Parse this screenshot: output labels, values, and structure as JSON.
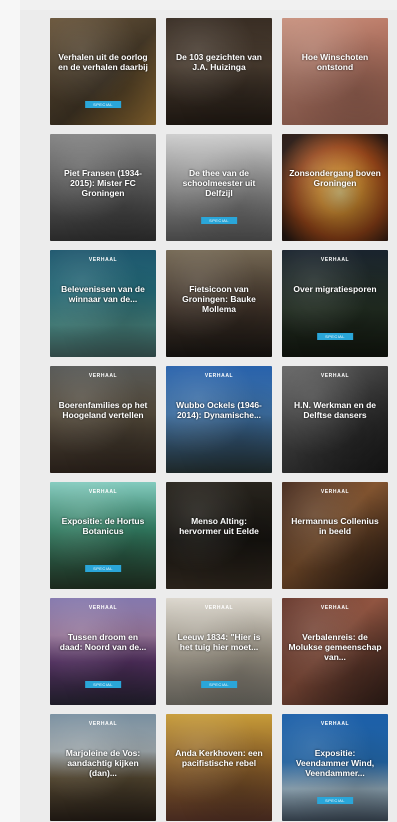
{
  "cards": [
    {
      "tag": "",
      "title": "Verhalen uit de oorlog en de verhalen daarbij",
      "badge": "SPECIAL",
      "meta": "",
      "bg": "linear-gradient(135deg,#6f5a3e,#4d3f2c 55%,#c08f42)"
    },
    {
      "tag": "",
      "title": "De 103 gezichten van J.A. Huizinga",
      "badge": "",
      "meta": "",
      "bg": "linear-gradient(180deg,#3b2f25,#5a4a3b 45%,#2b2119)"
    },
    {
      "tag": "",
      "title": "Hoe Winschoten ontstond",
      "badge": "",
      "meta": "",
      "bg": "linear-gradient(135deg,#d39a86,#c7836f 55%,#bf7b66)"
    },
    {
      "tag": "",
      "title": "Piet Fransen (1934-2015): Mister FC Groningen",
      "badge": "",
      "meta": "",
      "bg": "linear-gradient(180deg,#8b8b8b,#6d6d6d 55%,#3f3f3f)"
    },
    {
      "tag": "",
      "title": "De thee van de schoolmeester uit Delfzijl",
      "badge": "SPECIAL",
      "meta": "",
      "bg": "linear-gradient(180deg,#d9d9d9,#a7a7a7 55%,#6b6b6b)"
    },
    {
      "tag": "",
      "title": "Zonsondergang boven Groningen",
      "badge": "",
      "meta": "",
      "bg": "radial-gradient(circle at 55% 55%,#ffe08a 0%,#f2a339 25%,#a74d1c 55%,#2a1a14 85%)"
    },
    {
      "tag": "VERHAAL",
      "title": "Belevenissen van de winnaar van de...",
      "badge": "",
      "meta": "",
      "bg": "linear-gradient(180deg,#1f5b73,#2b7e8e 40%,#5aa7a1 70%,#4b6f6c)"
    },
    {
      "tag": "",
      "title": "Fietsicoon van Groningen: Bauke Mollema",
      "badge": "",
      "meta": "",
      "bg": "linear-gradient(180deg,#7a6d58,#4f3f33 55%,#1e1a16)"
    },
    {
      "tag": "VERHAAL",
      "title": "Over migratiesporen",
      "badge": "SPECIAL",
      "meta": "",
      "bg": "linear-gradient(180deg,#1b2530,#2c3b2c 55%,#151a11)"
    },
    {
      "tag": "VERHAAL",
      "title": "Boerenfamilies op het Hoogeland vertellen",
      "badge": "",
      "meta": "",
      "bg": "linear-gradient(180deg,#5a5c5a,#6a5e4b 45%,#3a2d24)"
    },
    {
      "tag": "VERHAAL",
      "title": "Wubbo Ockels (1946-2014): Dynamische...",
      "badge": "",
      "meta": "",
      "bg": "linear-gradient(180deg,#2a67b5,#4c8ac9 45%,#2d3c3e)"
    },
    {
      "tag": "VERHAAL",
      "title": "H.N. Werkman en de Delftse dansers",
      "badge": "",
      "meta": "",
      "bg": "linear-gradient(135deg,#6d6d6d,#3e3e3e 55%,#1e1e1e)"
    },
    {
      "tag": "VERHAAL",
      "title": "Expositie: de Hortus Botanicus",
      "badge": "SPECIAL",
      "meta": "",
      "bg": "linear-gradient(180deg,#8bd6c9,#3f9b7a 45%,#2b3f2c)"
    },
    {
      "tag": "",
      "title": "Menso Alting: hervormer uit Eelde",
      "badge": "",
      "meta": "",
      "bg": "linear-gradient(180deg,#2a261f,#1b1813 55%,#3f3428)"
    },
    {
      "tag": "VERHAAL",
      "title": "Hermannus Collenius in beeld",
      "badge": "",
      "meta": "",
      "bg": "linear-gradient(135deg,#4a2d1f,#8b5a33 45%,#2b1c14)"
    },
    {
      "tag": "VERHAAL",
      "title": "Tussen droom en daad: Noord van de...",
      "badge": "SPECIAL",
      "meta": "",
      "bg": "linear-gradient(180deg,#8b7fb7,#b28bb5 35%,#6b3f7d 60%,#2e2b3d)"
    },
    {
      "tag": "VERHAAL",
      "title": "Leeuw 1834: \"Hier is het tuig hier moet...",
      "badge": "SPECIAL",
      "meta": "",
      "bg": "linear-gradient(180deg,#e7e2d8,#bfb6a4 55%,#8e8a80)"
    },
    {
      "tag": "VERHAAL",
      "title": "Verbalenreis: de Molukse gemeenschap van...",
      "badge": "",
      "meta": "",
      "bg": "linear-gradient(135deg,#6d3b2f,#9a5a45 45%,#3a241d)"
    },
    {
      "tag": "VERHAAL",
      "title": "Marjoleine de Vos: aandachtig kijken (dan)...",
      "badge": "",
      "meta": "",
      "bg": "linear-gradient(180deg,#7f97a9,#b9c4c9 35%,#6b5b3f 60%,#2d231b)"
    },
    {
      "tag": "",
      "title": "Anda Kerkhoven: een pacifistische rebel",
      "badge": "",
      "meta": "",
      "bg": "linear-gradient(180deg,#d2a43b,#b07a34 45%,#6b3f2f)"
    },
    {
      "tag": "VERHAAL",
      "title": "Expositie: Veendammer Wind, Veendammer...",
      "badge": "SPECIAL",
      "meta": "",
      "bg": "linear-gradient(180deg,#1d64b2,#2a7bc9 45%,#b8d6e9 70%,#4a5a6b)"
    }
  ]
}
